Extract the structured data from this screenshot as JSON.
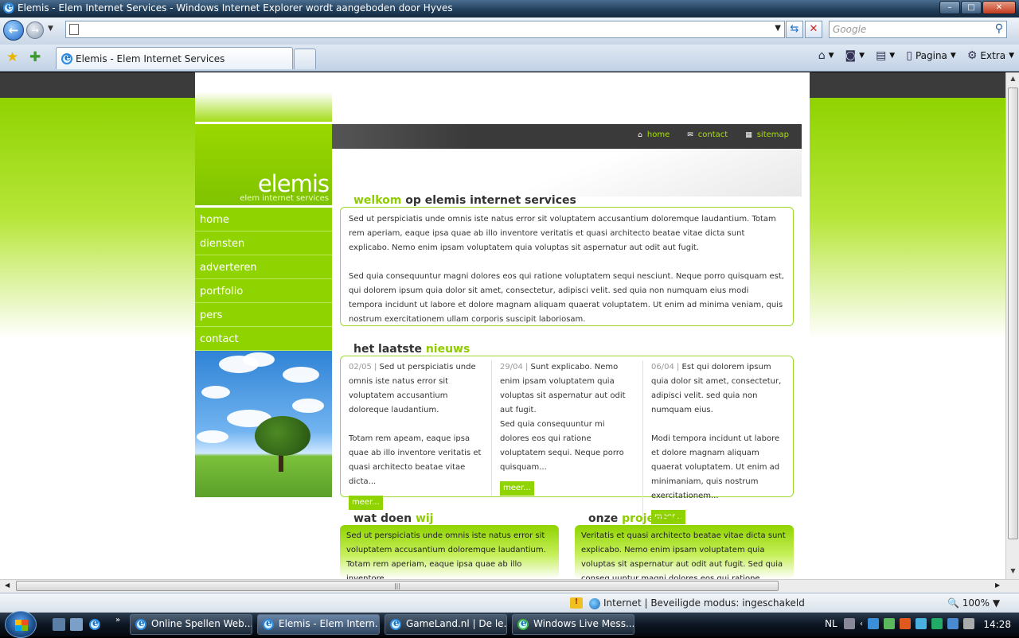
{
  "window": {
    "title": "Elemis - Elem Internet Services - Windows Internet Explorer wordt aangeboden door Hyves",
    "controls": {
      "minimize": "–",
      "maximize": "□",
      "close": "✕"
    }
  },
  "navbar": {
    "address_value": "",
    "search_placeholder": "Google",
    "back_glyph": "←",
    "forward_glyph": "→",
    "refresh_glyph": "⇆",
    "stop_glyph": "✕"
  },
  "tabbar": {
    "active_tab": "Elemis - Elem Internet Services",
    "page_label": "Pagina",
    "extra_label": "Extra"
  },
  "site": {
    "brand": "elemis",
    "tagline": "elem internet services",
    "sidenav": [
      "home",
      "diensten",
      "adverteren",
      "portfolio",
      "pers",
      "contact"
    ],
    "topnav": [
      {
        "icon": "⌂",
        "label": "home"
      },
      {
        "icon": "✉",
        "label": "contact"
      },
      {
        "icon": "▦",
        "label": "sitemap"
      }
    ],
    "welcome": {
      "title_green": "welkom",
      "title_rest": " op elemis internet services",
      "p1": "Sed ut perspiciatis unde omnis iste natus error sit voluptatem accusantium doloremque laudantium. Totam rem aperiam, eaque ipsa quae ab illo inventore veritatis et quasi architecto beatae vitae dicta sunt explicabo. Nemo enim ipsam voluptatem quia voluptas sit aspernatur aut odit aut fugit.",
      "p2": "Sed quia consequuntur magni dolores eos qui ratione voluptatem sequi nesciunt. Neque porro quisquam est, qui dolorem ipsum quia dolor sit amet, consectetur, adipisci velit. sed quia non numquam eius modi tempora incidunt ut labore et dolore magnam aliquam quaerat voluptatem. Ut enim ad minima veniam, quis nostrum exercitationem ullam corporis suscipit laboriosam."
    },
    "news": {
      "title_rest": "het laatste ",
      "title_green": "nieuws",
      "more": "meer...",
      "items": [
        {
          "date": "02/05 |",
          "p1": " Sed ut perspiciatis unde omnis iste natus error sit voluptatem accusantium doloreque laudantium.",
          "p2": "Totam rem apeam, eaque ipsa quae ab illo inventore veritatis et quasi architecto beatae vitae dicta..."
        },
        {
          "date": "29/04 |",
          "p1": " Sunt explicabo. Nemo enim ipsam voluptatem quia voluptas sit aspernatur aut odit aut fugit.",
          "p2": "Sed quia consequuntur mi dolores eos qui ratione voluptatem sequi. Neque porro quisquam..."
        },
        {
          "date": "06/04 |",
          "p1": " Est qui dolorem ipsum quia dolor sit amet, consectetur, adipisci velit. sed quia non numquam eius.",
          "p2": "Modi tempora incidunt ut labore et dolore magnam aliquam quaerat voluptatem. Ut enim ad minimaniam, quis nostrum exercitationem..."
        }
      ]
    },
    "wat_doen": {
      "title_rest": "wat doen ",
      "title_green": "wij",
      "text": "Sed ut perspiciatis unde omnis iste natus error sit voluptatem accusantium doloremque laudantium. Totam rem aperiam, eaque ipsa quae ab illo inventore."
    },
    "projecten": {
      "title_rest": "onze ",
      "title_green": "projecten",
      "text": "Veritatis et quasi architecto beatae vitae dicta sunt explicabo. Nemo enim ipsam voluptatem quia voluptas sit aspernatur aut odit aut fugit. Sed quia conseq uuntur magni dolores eos qui ratione"
    }
  },
  "status": {
    "zone": "Internet | Beveiligde modus: ingeschakeld",
    "zoom": "100%"
  },
  "taskbar": {
    "buttons": [
      "Online Spellen Web...",
      "Elemis - Elem Intern...",
      "GameLand.nl | De le...",
      "Windows Live Mess..."
    ],
    "language": "NL",
    "clock": "14:28"
  },
  "colors": {
    "accent": "#8fd300",
    "dark_band": "#3b3b3b"
  }
}
